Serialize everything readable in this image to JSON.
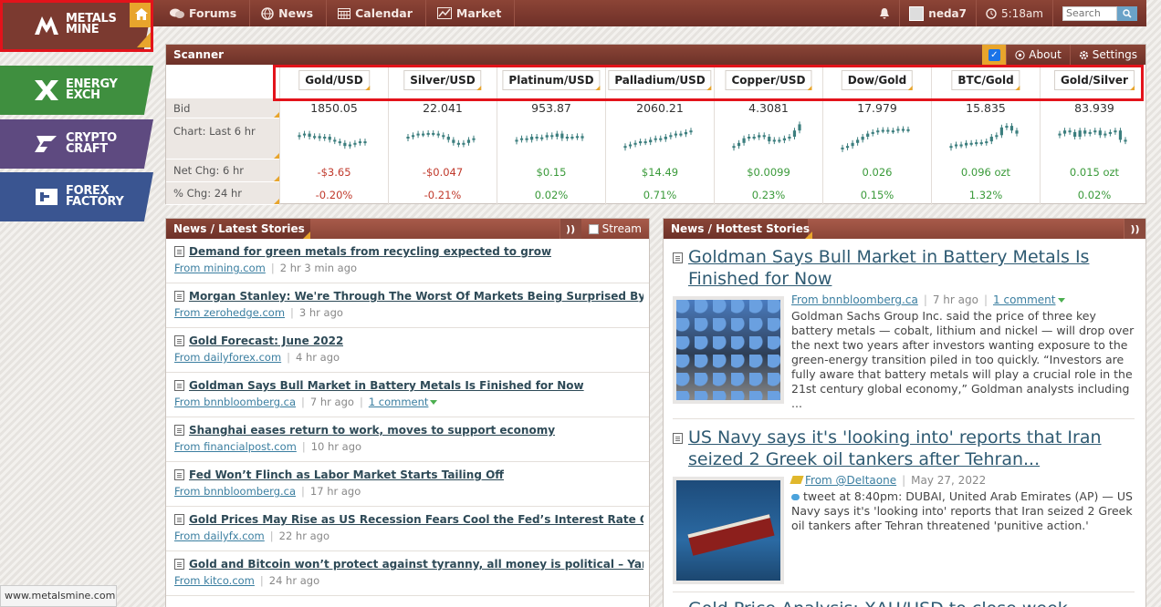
{
  "brands": {
    "metals": {
      "label_1": "METALS",
      "label_2": "MINE",
      "color": "#7b3a30"
    },
    "energy": {
      "label_1": "ENERGY",
      "label_2": "EXCH",
      "color": "#3f8f3f"
    },
    "crypto": {
      "label_1": "CRYPTO",
      "label_2": "CRAFT",
      "color": "#5e4a80"
    },
    "forex": {
      "label_1": "FOREX",
      "label_2": "FACTORY",
      "color": "#3a5591"
    }
  },
  "nav": {
    "forums": "Forums",
    "news": "News",
    "calendar": "Calendar",
    "market": "Market",
    "username": "neda7",
    "time": "5:18am",
    "search_placeholder": "Search"
  },
  "scanner": {
    "title": "Scanner",
    "about": "About",
    "settings": "Settings",
    "row_labels": {
      "bid": "Bid",
      "chart": "Chart: Last 6 hr",
      "net": "Net Chg: 6 hr",
      "pct": "% Chg: 24 hr"
    },
    "instruments": [
      {
        "symbol": "Gold/USD",
        "bid": "1850.05",
        "net": "-$3.65",
        "pct": "-0.20%",
        "dir": "neg",
        "trend": [
          0.55,
          0.6,
          0.5,
          0.52,
          0.45,
          0.5,
          0.4,
          0.35,
          0.3,
          0.2,
          0.25,
          0.3,
          0.35,
          0.3
        ]
      },
      {
        "symbol": "Silver/USD",
        "bid": "22.041",
        "net": "-$0.047",
        "pct": "-0.21%",
        "dir": "neg",
        "trend": [
          0.5,
          0.55,
          0.6,
          0.58,
          0.62,
          0.6,
          0.55,
          0.5,
          0.4,
          0.3,
          0.25,
          0.3,
          0.4,
          0.45
        ]
      },
      {
        "symbol": "Platinum/USD",
        "bid": "953.87",
        "net": "$0.15",
        "pct": "0.02%",
        "dir": "pos",
        "trend": [
          0.4,
          0.45,
          0.4,
          0.5,
          0.45,
          0.48,
          0.55,
          0.5,
          0.6,
          0.45,
          0.5,
          0.48,
          0.52,
          0.45
        ]
      },
      {
        "symbol": "Palladium/USD",
        "bid": "2060.21",
        "net": "$14.49",
        "pct": "0.71%",
        "dir": "pos",
        "trend": [
          0.2,
          0.25,
          0.3,
          0.35,
          0.32,
          0.4,
          0.45,
          0.42,
          0.5,
          0.55,
          0.6,
          0.58,
          0.65,
          0.7
        ]
      },
      {
        "symbol": "Copper/USD",
        "bid": "4.3081",
        "net": "$0.0099",
        "pct": "0.23%",
        "dir": "pos",
        "trend": [
          0.2,
          0.3,
          0.45,
          0.5,
          0.48,
          0.55,
          0.5,
          0.35,
          0.4,
          0.38,
          0.45,
          0.5,
          0.7,
          0.9
        ]
      },
      {
        "symbol": "Dow/Gold",
        "bid": "17.979",
        "net": "0.026",
        "pct": "0.15%",
        "dir": "pos",
        "trend": [
          0.15,
          0.2,
          0.3,
          0.4,
          0.5,
          0.6,
          0.65,
          0.7,
          0.72,
          0.68,
          0.7,
          0.75,
          0.72,
          0.74
        ]
      },
      {
        "symbol": "BTC/Gold",
        "bid": "15.835",
        "net": "0.096 ozt",
        "pct": "1.32%",
        "dir": "pos",
        "trend": [
          0.2,
          0.25,
          0.22,
          0.3,
          0.28,
          0.32,
          0.3,
          0.35,
          0.5,
          0.55,
          0.8,
          0.85,
          0.7,
          0.6
        ]
      },
      {
        "symbol": "Gold/Silver",
        "bid": "83.939",
        "net": "0.015 ozt",
        "pct": "0.02%",
        "dir": "pos",
        "trend": [
          0.6,
          0.7,
          0.65,
          0.5,
          0.7,
          0.6,
          0.65,
          0.7,
          0.55,
          0.6,
          0.65,
          0.7,
          0.4,
          0.35
        ]
      }
    ]
  },
  "latest": {
    "title": "News / Latest Stories",
    "stream_label": "Stream",
    "stories": [
      {
        "title": "Demand for green metals from recycling expected to grow",
        "src": "From mining.com",
        "age": "2 hr 3 min ago"
      },
      {
        "title": "Morgan Stanley: We're Through The Worst Of Markets Being Surprised By Infla",
        "src": "From zerohedge.com",
        "age": "3 hr ago"
      },
      {
        "title": "Gold Forecast: June 2022",
        "src": "From dailyforex.com",
        "age": "4 hr ago"
      },
      {
        "title": "Goldman Says Bull Market in Battery Metals Is Finished for Now",
        "src": "From bnnbloomberg.ca",
        "age": "7 hr ago",
        "comment": "1 comment"
      },
      {
        "title": "Shanghai eases return to work, moves to support economy",
        "src": "From financialpost.com",
        "age": "10 hr ago"
      },
      {
        "title": "Fed Won’t Flinch as Labor Market Starts Tailing Off",
        "src": "From bnnbloomberg.ca",
        "age": "17 hr ago"
      },
      {
        "title": "Gold Prices May Rise as US Recession Fears Cool the Fed’s Interest Rate Outlo",
        "src": "From dailyfx.com",
        "age": "22 hr ago"
      },
      {
        "title": "Gold and Bitcoin won’t protect against tyranny, all money is political – Yanis Va",
        "src": "From kitco.com",
        "age": "24 hr ago"
      }
    ]
  },
  "hottest": {
    "title": "News / Hottest Stories",
    "stories": [
      {
        "title": "Goldman Says Bull Market in Battery Metals Is Finished for Now",
        "src": "From bnnbloomberg.ca",
        "age": "7 hr ago",
        "comment": "1 comment",
        "body": "Goldman Sachs Group Inc. said the price of three key battery metals — cobalt, lithium and nickel — will drop over the next two years after investors wanting exposure to the green-energy transition piled in too quickly. “Investors are fully aware that battery metals will play a crucial role in the 21st century global economy,” Goldman analysts including ..."
      },
      {
        "title": "US Navy says it's 'looking into' reports that Iran seized 2 Greek oil tankers after Tehran...",
        "src": "From @DeItaone",
        "age": "May 27, 2022",
        "body": "tweet at 8:40pm: DUBAI, United Arab Emirates (AP) — US Navy says it's 'looking into' reports that Iran seized 2 Greek oil tankers after Tehran threatened 'punitive action.'"
      }
    ],
    "partial_title": "Gold Price Analysis: XAU/USD to close week..."
  },
  "status_url": "www.metalsmine.com"
}
